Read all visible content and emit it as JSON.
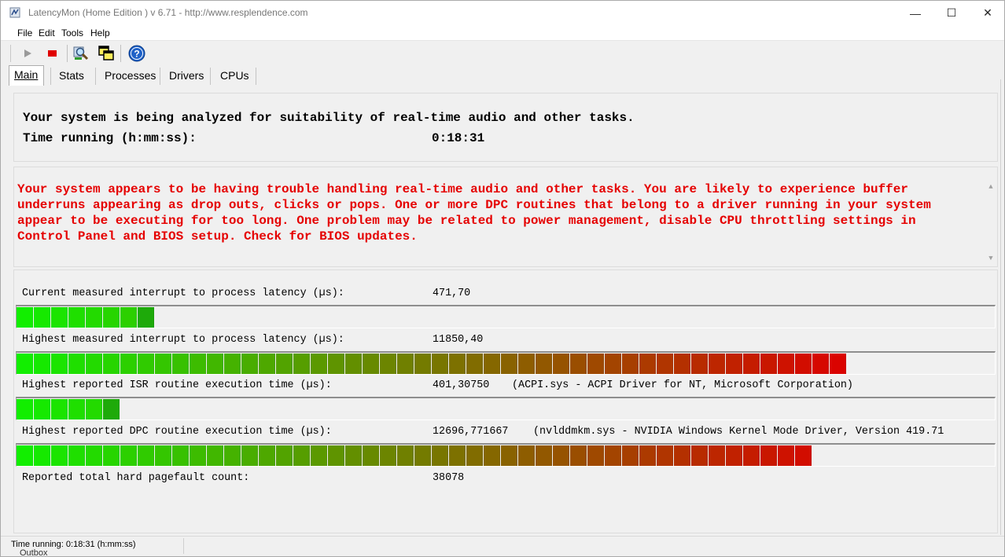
{
  "window": {
    "title": "LatencyMon  (Home Edition )  v 6.71 - http://www.resplendence.com",
    "minimize_glyph": "—",
    "maximize_glyph": "☐",
    "close_glyph": "✕"
  },
  "menu": {
    "file": "File",
    "edit": "Edit",
    "tools": "Tools",
    "help": "Help"
  },
  "toolbar": {
    "icons": [
      "play-icon",
      "stop-icon",
      "magnifier-icon",
      "copy-windows-icon",
      "help-icon"
    ]
  },
  "tabs": [
    "Main",
    "Stats",
    "Processes",
    "Drivers",
    "CPUs"
  ],
  "main": {
    "analyzing_text": "Your system is being analyzed for suitability of real-time audio and other tasks.",
    "time_running_label": "Time running (h:mm:ss):",
    "time_running_value": "0:18:31",
    "warning_lines": [
      "Your system appears to be having trouble handling real-time audio and other tasks. You are likely to experience buffer",
      "underruns appearing as drop outs, clicks or pops. One or more DPC routines that belong to a driver running in your system",
      "appear to be executing for too long. One problem may be related to power management, disable CPU throttling settings in",
      "Control Panel and BIOS setup. Check for BIOS updates."
    ],
    "warning_color": "#e50000",
    "metrics": [
      {
        "label": "Current measured interrupt to process latency (µs):",
        "value": "471,70",
        "extra": "",
        "segments": 8
      },
      {
        "label": "Highest measured interrupt to process latency (µs):",
        "value": "11850,40",
        "extra": "",
        "segments": 48
      },
      {
        "label": "Highest reported ISR routine execution time (µs):",
        "value": "401,30750",
        "extra": "(ACPI.sys - ACPI Driver for NT, Microsoft Corporation)",
        "segments": 6
      },
      {
        "label": "Highest reported DPC routine execution time (µs):",
        "value": "12696,771667",
        "extra": "(nvlddmkm.sys - NVIDIA Windows Kernel Mode Driver, Version 419.71",
        "segments": 46
      }
    ],
    "pagefault_label": "Reported total hard pagefault count:",
    "pagefault_value": "38078",
    "bar_colors": {
      "start": "#12ee00",
      "end": "#dd0000"
    }
  },
  "statusbar": {
    "text": "Time running: 0:18:31  (h:mm:ss)"
  },
  "background": {
    "outbox_text": "Outbox"
  }
}
